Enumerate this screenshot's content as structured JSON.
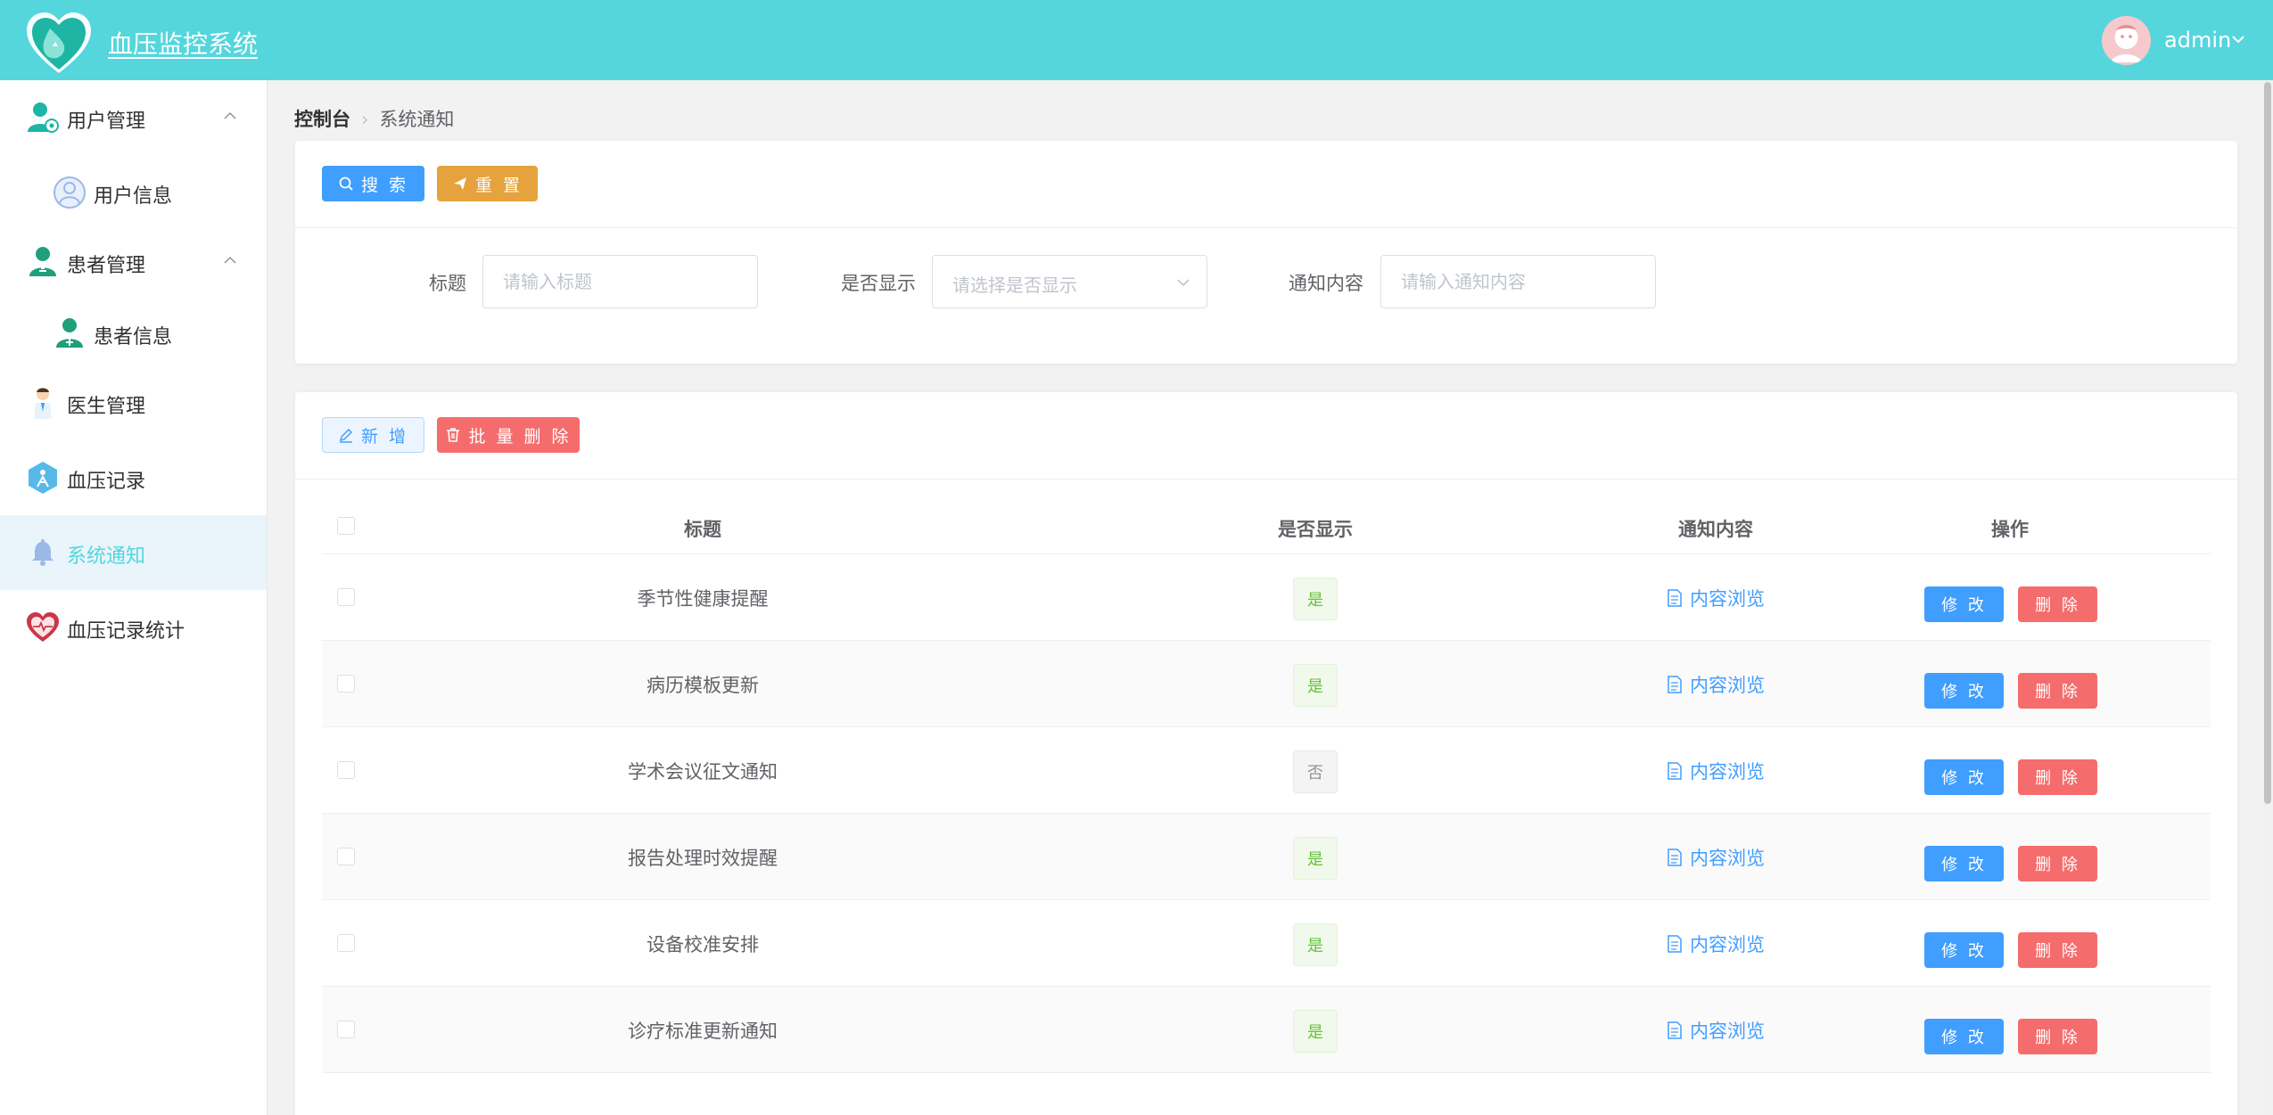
{
  "app": {
    "title": "血压监控系统",
    "user": "admin"
  },
  "sidebar": {
    "items": [
      {
        "label": "用户管理",
        "icon": "user-manage-icon",
        "expanded": true
      },
      {
        "label": "用户信息",
        "icon": "user-info-icon"
      },
      {
        "label": "患者管理",
        "icon": "patient-manage-icon",
        "expanded": true
      },
      {
        "label": "患者信息",
        "icon": "patient-info-icon"
      },
      {
        "label": "医生管理",
        "icon": "doctor-icon"
      },
      {
        "label": "血压记录",
        "icon": "bp-record-icon"
      },
      {
        "label": "系统通知",
        "icon": "bell-icon",
        "active": true
      },
      {
        "label": "血压记录统计",
        "icon": "heart-stat-icon"
      }
    ]
  },
  "breadcrumb": {
    "home": "控制台",
    "current": "系统通知"
  },
  "search": {
    "search_btn": "搜 索",
    "reset_btn": "重 置",
    "title_label": "标题",
    "title_placeholder": "请输入标题",
    "show_label": "是否显示",
    "show_placeholder": "请选择是否显示",
    "content_label": "通知内容",
    "content_placeholder": "请输入通知内容"
  },
  "toolbar": {
    "add_btn": "新 增",
    "batch_delete_btn": "批 量 删 除"
  },
  "table": {
    "headers": [
      "标题",
      "是否显示",
      "通知内容",
      "操作"
    ],
    "view_label": "内容浏览",
    "edit_label": "修 改",
    "delete_label": "删 除",
    "rows": [
      {
        "title": "季节性健康提醒",
        "show": "是"
      },
      {
        "title": "病历模板更新",
        "show": "是"
      },
      {
        "title": "学术会议征文通知",
        "show": "否"
      },
      {
        "title": "报告处理时效提醒",
        "show": "是"
      },
      {
        "title": "设备校准安排",
        "show": "是"
      },
      {
        "title": "诊疗标准更新通知",
        "show": "是"
      }
    ]
  },
  "colors": {
    "header": "#54d6dc",
    "primary": "#409eff",
    "warning": "#e6a23c",
    "danger": "#f56c6c",
    "success": "#67c23a"
  }
}
